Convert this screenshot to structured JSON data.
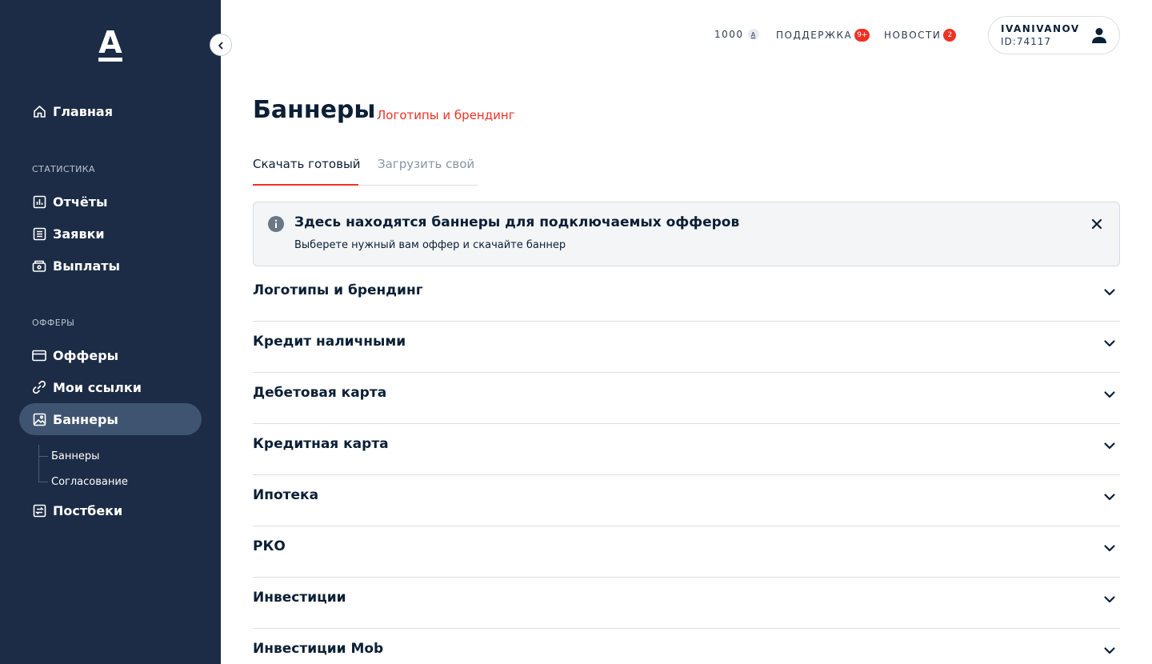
{
  "brand": {
    "logo_letter": "A",
    "accent": "#ef3124",
    "sidebar_bg": "#1c2c46"
  },
  "sidebar": {
    "home": {
      "label": "Главная",
      "icon": "home-icon"
    },
    "sections": [
      {
        "label": "СТАТИСТИКА",
        "items": [
          {
            "label": "Отчёты",
            "icon": "chart-icon"
          },
          {
            "label": "Заявки",
            "icon": "list-icon"
          },
          {
            "label": "Выплаты",
            "icon": "wallet-icon"
          }
        ]
      },
      {
        "label": "ОФФЕРЫ",
        "items": [
          {
            "label": "Офферы",
            "icon": "card-icon"
          },
          {
            "label": "Мои ссылки",
            "icon": "link-icon"
          },
          {
            "label": "Баннеры",
            "icon": "image-icon",
            "active": true
          }
        ]
      }
    ],
    "sub_items": [
      "Баннеры",
      "Согласование"
    ],
    "postbacks": {
      "label": "Постбеки",
      "icon": "postback-icon"
    }
  },
  "topbar": {
    "balance": "1000",
    "balance_currency": "A",
    "support": {
      "label": "ПОДДЕРЖКА",
      "badge": "9+"
    },
    "news": {
      "label": "НОВОСТИ",
      "badge": "2"
    },
    "user": {
      "name": "IVANIVANOV",
      "id": "ID:74117"
    }
  },
  "main": {
    "title": "Баннеры",
    "subtitle": "Логотипы и брендинг",
    "tabs": [
      {
        "label": "Скачать готовый",
        "active": true
      },
      {
        "label": "Загрузить свой",
        "active": false
      }
    ],
    "alert": {
      "title": "Здесь находятся баннеры для подключаемых офферов",
      "text": "Выберете нужный вам оффер и скачайте баннер"
    },
    "accordion": [
      "Логотипы и брендинг",
      "Кредит наличными",
      "Дебетовая карта",
      "Кредитная карта",
      "Ипотека",
      "РКО",
      "Инвестиции",
      "Инвестиции Mob"
    ]
  }
}
